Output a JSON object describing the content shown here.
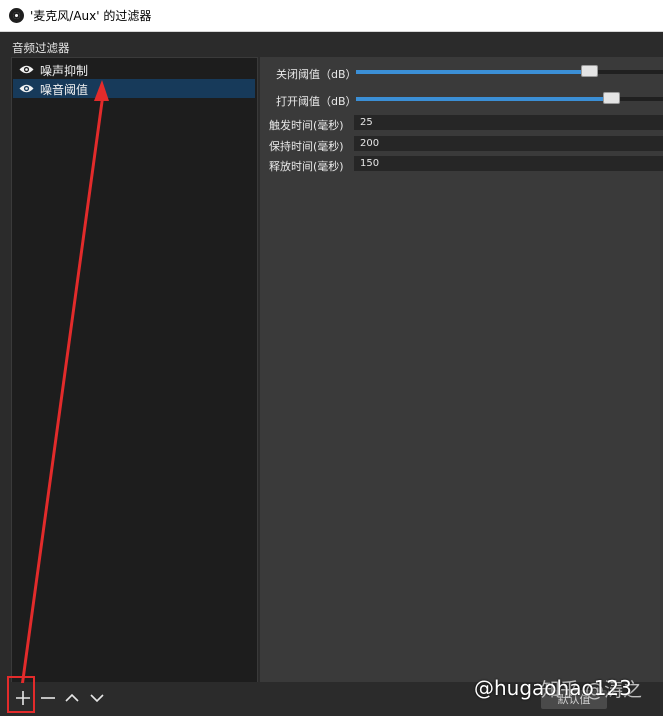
{
  "window": {
    "title": "'麦克风/Aux' 的过滤器"
  },
  "filters_panel": {
    "label": "音频过滤器",
    "items": [
      {
        "label": "噪声抑制",
        "visible": true,
        "selected": false
      },
      {
        "label": "噪音阈值",
        "visible": true,
        "selected": true
      }
    ]
  },
  "settings": {
    "close_threshold": {
      "label": "关闭阈值（dB）",
      "level_fraction": 0.76
    },
    "open_threshold": {
      "label": "打开阈值（dB）",
      "level_fraction": 0.83
    },
    "attack_time": {
      "label": "触发时间(毫秒)",
      "value": "25"
    },
    "hold_time": {
      "label": "保持时间(毫秒)",
      "value": "200"
    },
    "release_time": {
      "label": "释放时间(毫秒)",
      "value": "150"
    }
  },
  "toolbar": {
    "add_icon": "plus-icon",
    "remove_icon": "minus-icon",
    "up_icon": "chevron-up-icon",
    "down_icon": "chevron-down-icon"
  },
  "defaults_button": {
    "label": "默认值"
  },
  "watermark": {
    "text": "@hugaohao123",
    "text2": "知乎 @涛之"
  },
  "colors": {
    "accent": "#3b8fd6",
    "selection": "#173a5a",
    "annotation": "#e32b2b"
  }
}
